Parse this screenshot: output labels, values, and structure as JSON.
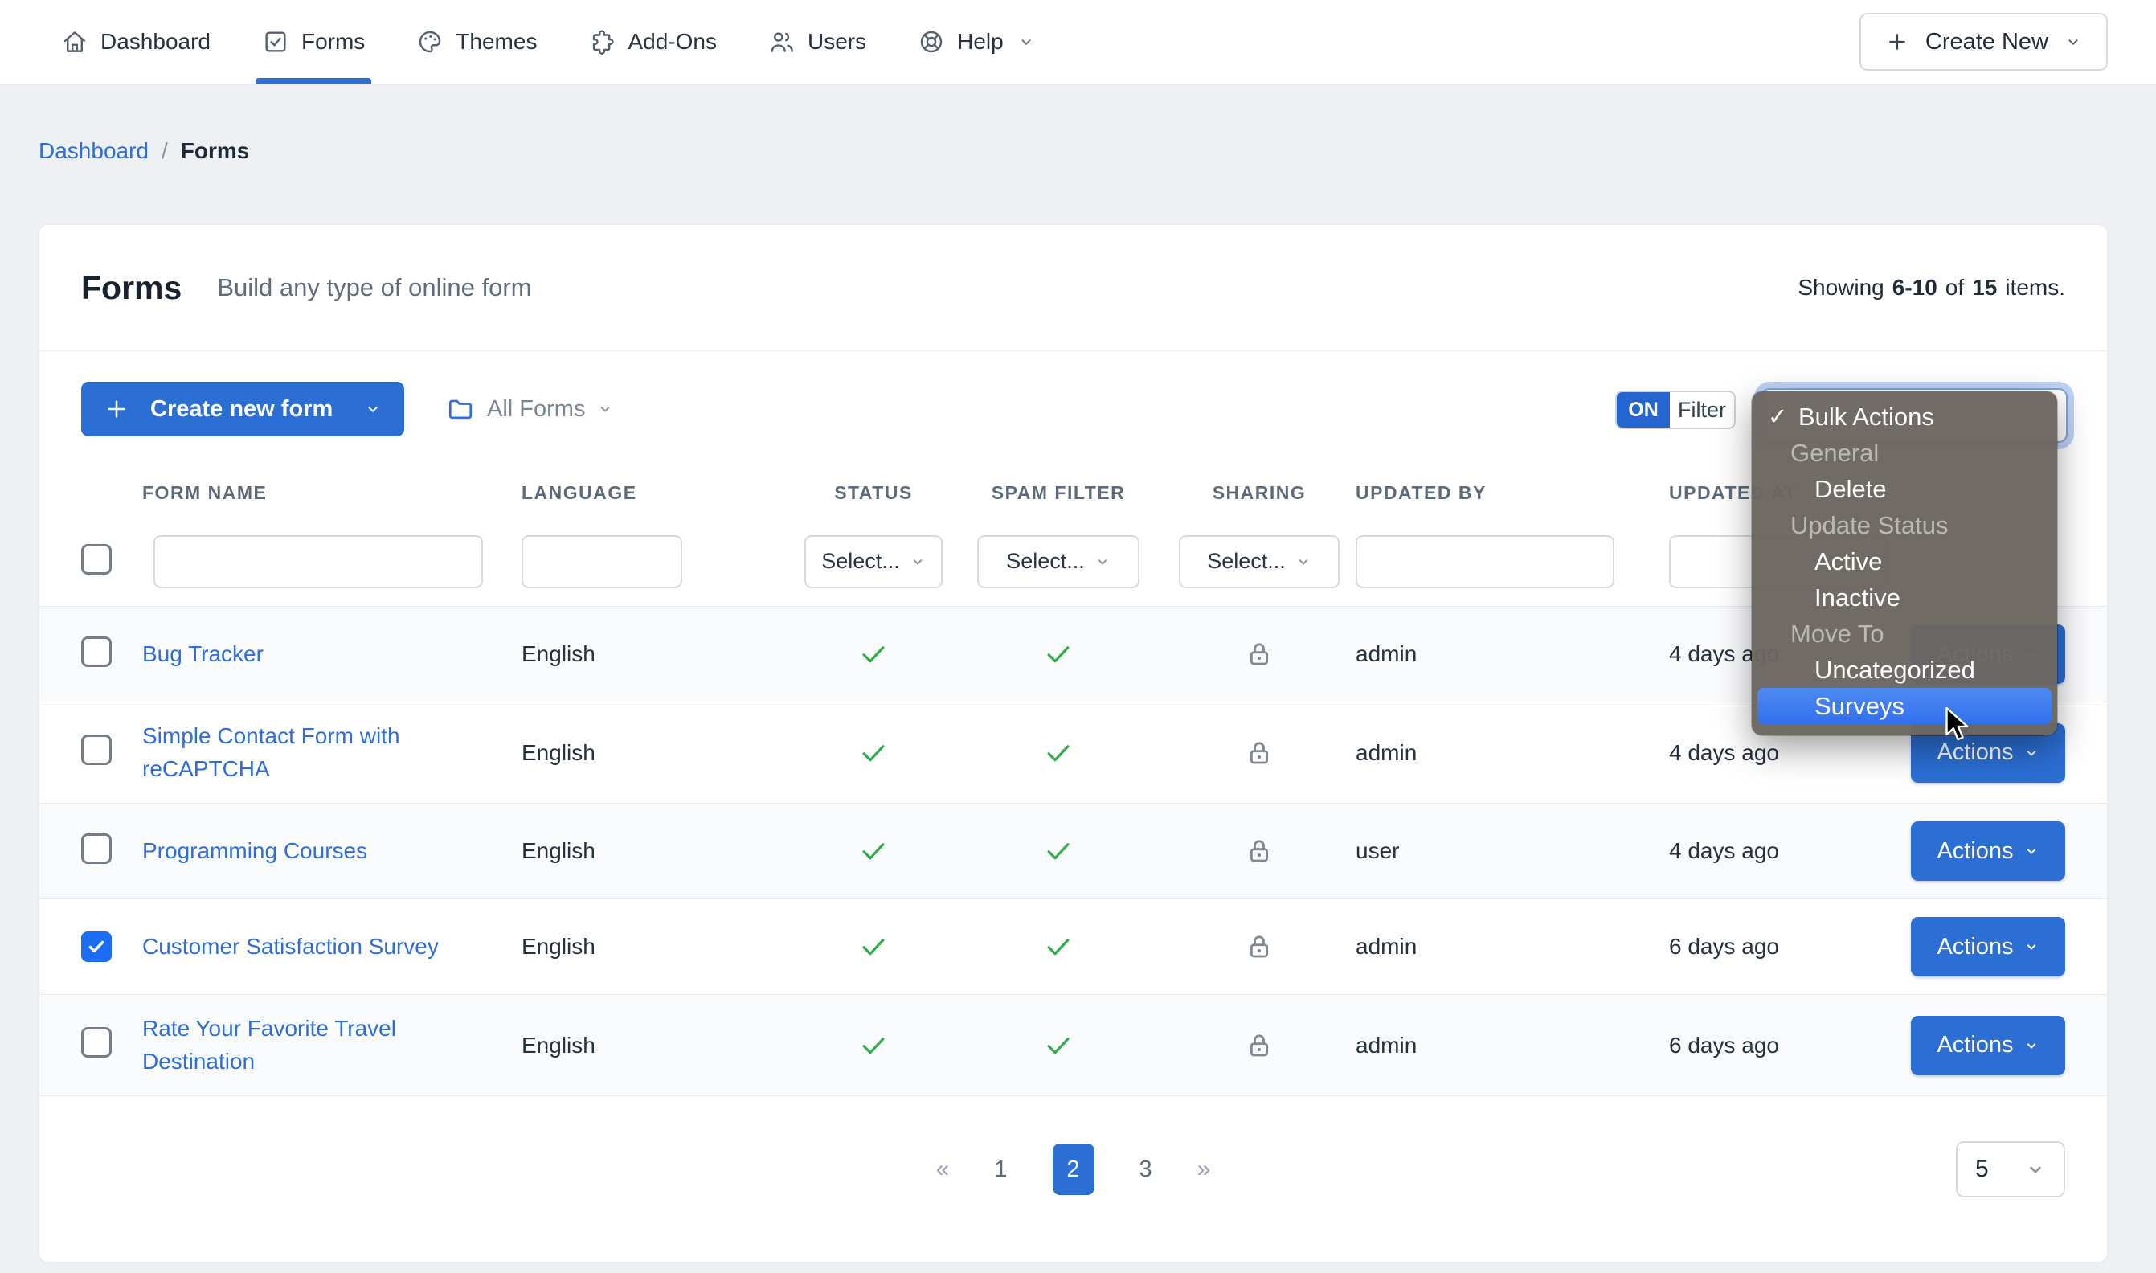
{
  "nav": {
    "items": [
      {
        "label": "Dashboard",
        "icon": "home-icon"
      },
      {
        "label": "Forms",
        "icon": "forms-icon"
      },
      {
        "label": "Themes",
        "icon": "palette-icon"
      },
      {
        "label": "Add-Ons",
        "icon": "puzzle-icon"
      },
      {
        "label": "Users",
        "icon": "users-icon"
      },
      {
        "label": "Help",
        "icon": "help-icon"
      }
    ],
    "active_item": "Forms",
    "create_new_label": "Create New"
  },
  "breadcrumb": {
    "link": "Dashboard",
    "separator": "/",
    "current": "Forms"
  },
  "header": {
    "title": "Forms",
    "subtitle": "Build any type of online form",
    "showing": {
      "prefix": "Showing",
      "range": "6-10",
      "of": "of",
      "total": "15",
      "suffix": "items."
    }
  },
  "toolbar": {
    "create_form_label": "Create new form",
    "forms_filter_label": "All Forms",
    "toggle_on": "ON",
    "toggle_filter": "Filter"
  },
  "bulk_menu": {
    "items": [
      {
        "label": "Bulk Actions",
        "type": "selected"
      },
      {
        "label": "General",
        "type": "group"
      },
      {
        "label": "Delete",
        "type": "item"
      },
      {
        "label": "Update Status",
        "type": "group"
      },
      {
        "label": "Active",
        "type": "item"
      },
      {
        "label": "Inactive",
        "type": "item"
      },
      {
        "label": "Move To",
        "type": "group"
      },
      {
        "label": "Uncategorized",
        "type": "item"
      },
      {
        "label": "Surveys",
        "type": "item",
        "highlighted": true
      }
    ]
  },
  "table": {
    "headers": [
      "FORM NAME",
      "LANGUAGE",
      "STATUS",
      "SPAM FILTER",
      "SHARING",
      "UPDATED BY",
      "UPDATED AT"
    ],
    "filter_placeholder": "Select...",
    "actions_label": "Actions",
    "rows": [
      {
        "name": "Bug Tracker",
        "language": "English",
        "status": "active",
        "spam_filter": "active",
        "sharing": "locked",
        "updated_by": "admin",
        "updated_at": "4 days ago",
        "checked": false
      },
      {
        "name": "Simple Contact Form with reCAPTCHA",
        "language": "English",
        "status": "active",
        "spam_filter": "active",
        "sharing": "locked",
        "updated_by": "admin",
        "updated_at": "4 days ago",
        "checked": false
      },
      {
        "name": "Programming Courses",
        "language": "English",
        "status": "active",
        "spam_filter": "active",
        "sharing": "locked",
        "updated_by": "user",
        "updated_at": "4 days ago",
        "checked": false
      },
      {
        "name": "Customer Satisfaction Survey",
        "language": "English",
        "status": "active",
        "spam_filter": "active",
        "sharing": "locked",
        "updated_by": "admin",
        "updated_at": "6 days ago",
        "checked": true
      },
      {
        "name": "Rate Your Favorite Travel Destination",
        "language": "English",
        "status": "active",
        "spam_filter": "active",
        "sharing": "locked",
        "updated_by": "admin",
        "updated_at": "6 days ago",
        "checked": false
      }
    ]
  },
  "pagination": {
    "first": "«",
    "pages": [
      "1",
      "2",
      "3"
    ],
    "active_page": "2",
    "last": "»",
    "per_page": "5"
  },
  "colors": {
    "primary_blue": "#2b6fd4",
    "link_blue": "#2c6fdb",
    "success_green": "#2fad49",
    "menu_bg": "#6c6661",
    "menu_highlight": "#3b7cf2",
    "toggle_on_blue": "#2565d0",
    "page_bg": "#eef0f4"
  }
}
